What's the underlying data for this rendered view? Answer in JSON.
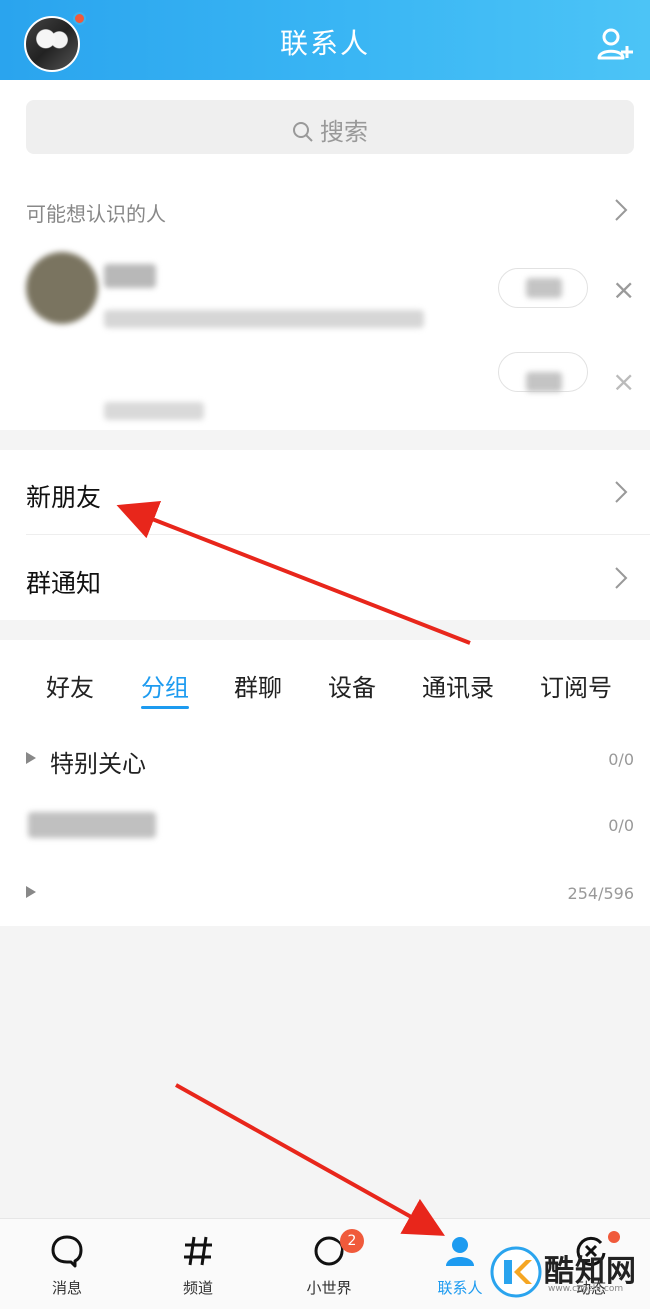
{
  "header": {
    "title": "联系人"
  },
  "search": {
    "placeholder": "搜索"
  },
  "suggestions": {
    "title": "可能想认识的人"
  },
  "rows": {
    "new_friends": "新朋友",
    "group_notice": "群通知"
  },
  "tabs": [
    {
      "label": "好友",
      "active": false
    },
    {
      "label": "分组",
      "active": true
    },
    {
      "label": "群聊",
      "active": false
    },
    {
      "label": "设备",
      "active": false
    },
    {
      "label": "通讯录",
      "active": false
    },
    {
      "label": "订阅号",
      "active": false
    }
  ],
  "groups": [
    {
      "name": "特别关心",
      "count": "0/0"
    },
    {
      "name": "",
      "count": "0/0"
    },
    {
      "name": "",
      "count": "254/596"
    }
  ],
  "bottom_nav": [
    {
      "label": "消息",
      "icon": "message-icon",
      "active": false
    },
    {
      "label": "频道",
      "icon": "hash-icon",
      "active": false
    },
    {
      "label": "小世界",
      "icon": "world-icon",
      "active": false,
      "badge": "2"
    },
    {
      "label": "联系人",
      "icon": "contacts-icon",
      "active": true
    },
    {
      "label": "动态",
      "icon": "star-icon",
      "active": false
    }
  ],
  "watermark": {
    "name": "酷知网",
    "url": "www.coozhi.com"
  },
  "colors": {
    "accent": "#1d9bf0",
    "header_start": "#2aa4ee",
    "header_end": "#4cc4f6",
    "badge": "#f05a3b",
    "arrow": "#e8261b"
  }
}
